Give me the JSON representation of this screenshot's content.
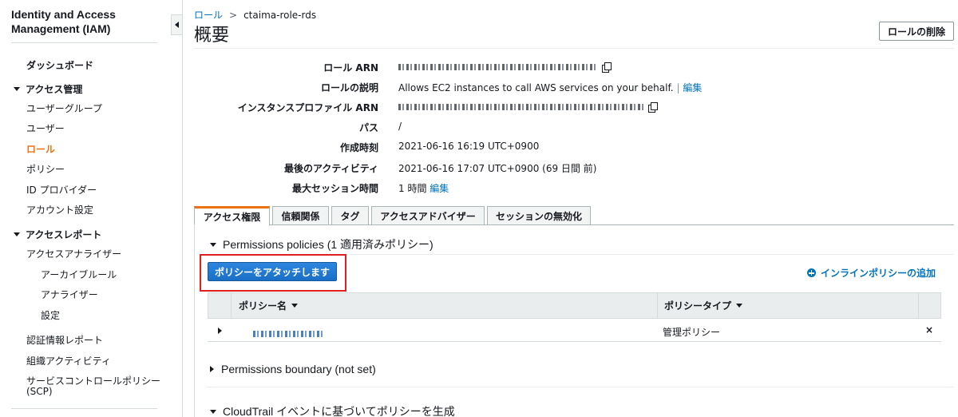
{
  "sidebar": {
    "title": "Identity and Access Management (IAM)",
    "dashboard": "ダッシュボード",
    "access_mgmt": {
      "label": "アクセス管理",
      "items": [
        "ユーザーグループ",
        "ユーザー",
        "ロール",
        "ポリシー",
        "ID プロバイダー",
        "アカウント設定"
      ]
    },
    "access_reports": {
      "label": "アクセスレポート",
      "analyzer": "アクセスアナライザー",
      "analyzer_items": [
        "アーカイブルール",
        "アナライザー",
        "設定"
      ],
      "items": [
        "認証情報レポート",
        "組織アクティビティ",
        "サービスコントロールポリシー",
        "(SCP)"
      ]
    },
    "active_item": "ロール"
  },
  "breadcrumb": {
    "parent": "ロール",
    "current": "ctaima-role-rds"
  },
  "page": {
    "title": "概要",
    "delete_button": "ロールの削除"
  },
  "summary": {
    "role_arn": {
      "label": "ロール ARN",
      "value": ""
    },
    "description": {
      "label": "ロールの説明",
      "value": "Allows EC2 instances to call AWS services on your behalf.",
      "sep": "|",
      "edit": "編集"
    },
    "instance_profile_arn": {
      "label": "インスタンスプロファイル ARN",
      "value": ""
    },
    "path": {
      "label": "パス",
      "value": "/"
    },
    "created": {
      "label": "作成時刻",
      "value": "2021-06-16 16:19 UTC+0900"
    },
    "last_activity": {
      "label": "最後のアクティビティ",
      "value": "2021-06-16 17:07 UTC+0900 (69 日間 前)"
    },
    "max_session": {
      "label": "最大セッション時間",
      "value": "1 時間",
      "edit": "編集"
    }
  },
  "tabs": [
    "アクセス権限",
    "信頼関係",
    "タグ",
    "アクセスアドバイザー",
    "セッションの無効化"
  ],
  "active_tab": "アクセス権限",
  "permissions": {
    "heading": "Permissions policies (1 適用済みポリシー)",
    "attach_button": "ポリシーをアタッチします",
    "inline_add": "インラインポリシーの追加",
    "columns": [
      "ポリシー名",
      "ポリシータイプ"
    ],
    "rows": [
      {
        "name": "",
        "type": "管理ポリシー",
        "remove": "×"
      }
    ]
  },
  "boundary": {
    "heading": "Permissions boundary (not set)"
  },
  "cloudtrail": {
    "heading": "CloudTrail イベントに基づいてポリシーを生成"
  },
  "colors": {
    "accent": "#ec7211",
    "link": "#0073bb",
    "highlight": "#e02020",
    "primary_button": "#1a6fc6"
  }
}
